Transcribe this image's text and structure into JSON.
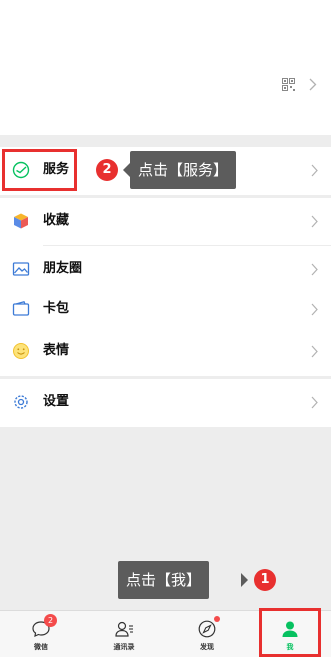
{
  "menu": {
    "service_label": "服务",
    "favorites_label": "收藏",
    "moments_label": "朋友圈",
    "cards_label": "卡包",
    "stickers_label": "表情",
    "settings_label": "设置"
  },
  "annotations": {
    "step1_number": "1",
    "step1_text": "点击【我】",
    "step2_number": "2",
    "step2_text": "点击【服务】"
  },
  "tabbar": {
    "chats_label": "微信",
    "chats_badge": "2",
    "contacts_label": "通讯录",
    "discover_label": "发现",
    "me_label": "我"
  },
  "colors": {
    "accent_green": "#07c160",
    "annotation_red": "#e8302f",
    "tooltip_gray": "#5c5c5c"
  },
  "icons": {
    "service": "service-icon",
    "favorites": "favorites-icon",
    "moments": "moments-icon",
    "cards": "card-wallet-icon",
    "stickers": "smiley-icon",
    "settings": "gear-icon"
  }
}
